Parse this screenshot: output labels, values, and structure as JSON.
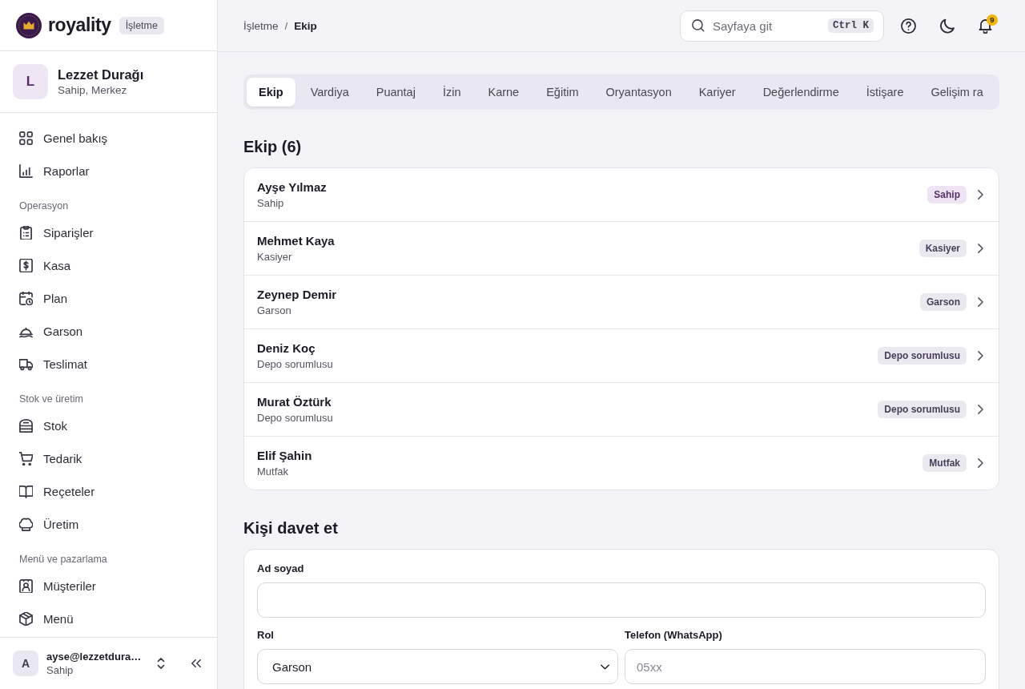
{
  "brand": {
    "name": "royality",
    "badge": "İşletme"
  },
  "organization": {
    "initial": "L",
    "name": "Lezzet Durağı",
    "subtitle": "Sahip, Merkez"
  },
  "sidebar": {
    "sections": [
      {
        "items": [
          {
            "label": "Genel bakış"
          },
          {
            "label": "Raporlar"
          }
        ]
      },
      {
        "title": "Operasyon",
        "items": [
          {
            "label": "Siparişler"
          },
          {
            "label": "Kasa"
          },
          {
            "label": "Plan"
          },
          {
            "label": "Garson"
          },
          {
            "label": "Teslimat"
          }
        ]
      },
      {
        "title": "Stok ve üretim",
        "items": [
          {
            "label": "Stok"
          },
          {
            "label": "Tedarik"
          },
          {
            "label": "Reçeteler"
          },
          {
            "label": "Üretim"
          }
        ]
      },
      {
        "title": "Menü ve pazarlama",
        "items": [
          {
            "label": "Müşteriler"
          },
          {
            "label": "Menü"
          }
        ]
      }
    ]
  },
  "account": {
    "initial": "A",
    "email": "ayse@lezzetdura…",
    "role": "Sahip"
  },
  "breadcrumb": {
    "items": [
      "İşletme",
      "Ekip"
    ],
    "separator": "/"
  },
  "search": {
    "placeholder": "Sayfaya git",
    "shortcut": "Ctrl K"
  },
  "notifications": {
    "count": "9"
  },
  "tabs": [
    {
      "label": "Ekip",
      "selected": true
    },
    {
      "label": "Vardiya",
      "selected": false
    },
    {
      "label": "Puantaj",
      "selected": false
    },
    {
      "label": "İzin",
      "selected": false
    },
    {
      "label": "Karne",
      "selected": false
    },
    {
      "label": "Eğitim",
      "selected": false
    },
    {
      "label": "Oryantasyon",
      "selected": false
    },
    {
      "label": "Kariyer",
      "selected": false
    },
    {
      "label": "Değerlendirme",
      "selected": false
    },
    {
      "label": "İstişare",
      "selected": false
    },
    {
      "label": "Gelişim ra",
      "selected": false
    }
  ],
  "team": {
    "title": "Ekip (6)",
    "members": [
      {
        "name": "Ayşe Yılmaz",
        "role": "Sahip",
        "tag": {
          "label": "Sahip",
          "color": "#eee3f3"
        }
      },
      {
        "name": "Mehmet Kaya",
        "role": "Kasiyer",
        "tag": {
          "label": "Kasiyer",
          "color": "#ebe9f0"
        }
      },
      {
        "name": "Zeynep Demir",
        "role": "Garson",
        "tag": {
          "label": "Garson",
          "color": "#ebe9f0"
        }
      },
      {
        "name": "Deniz Koç",
        "role": "Depo sorumlusu",
        "tag": {
          "label": "Depo sorumlusu",
          "color": "#ebe9f0"
        }
      },
      {
        "name": "Murat Öztürk",
        "role": "Depo sorumlusu",
        "tag": {
          "label": "Depo sorumlusu",
          "color": "#ebe9f0"
        }
      },
      {
        "name": "Elif Şahin",
        "role": "Mutfak",
        "tag": {
          "label": "Mutfak",
          "color": "#ebe9f0"
        }
      }
    ]
  },
  "invite": {
    "title": "Kişi davet et",
    "rows": [
      [
        {
          "kind": "text",
          "label": "Ad soyad"
        }
      ],
      [
        {
          "kind": "select",
          "label": "Rol",
          "value": "Garson"
        },
        {
          "kind": "text",
          "label": "Telefon (WhatsApp)",
          "placeholder": "05xx"
        }
      ]
    ]
  }
}
